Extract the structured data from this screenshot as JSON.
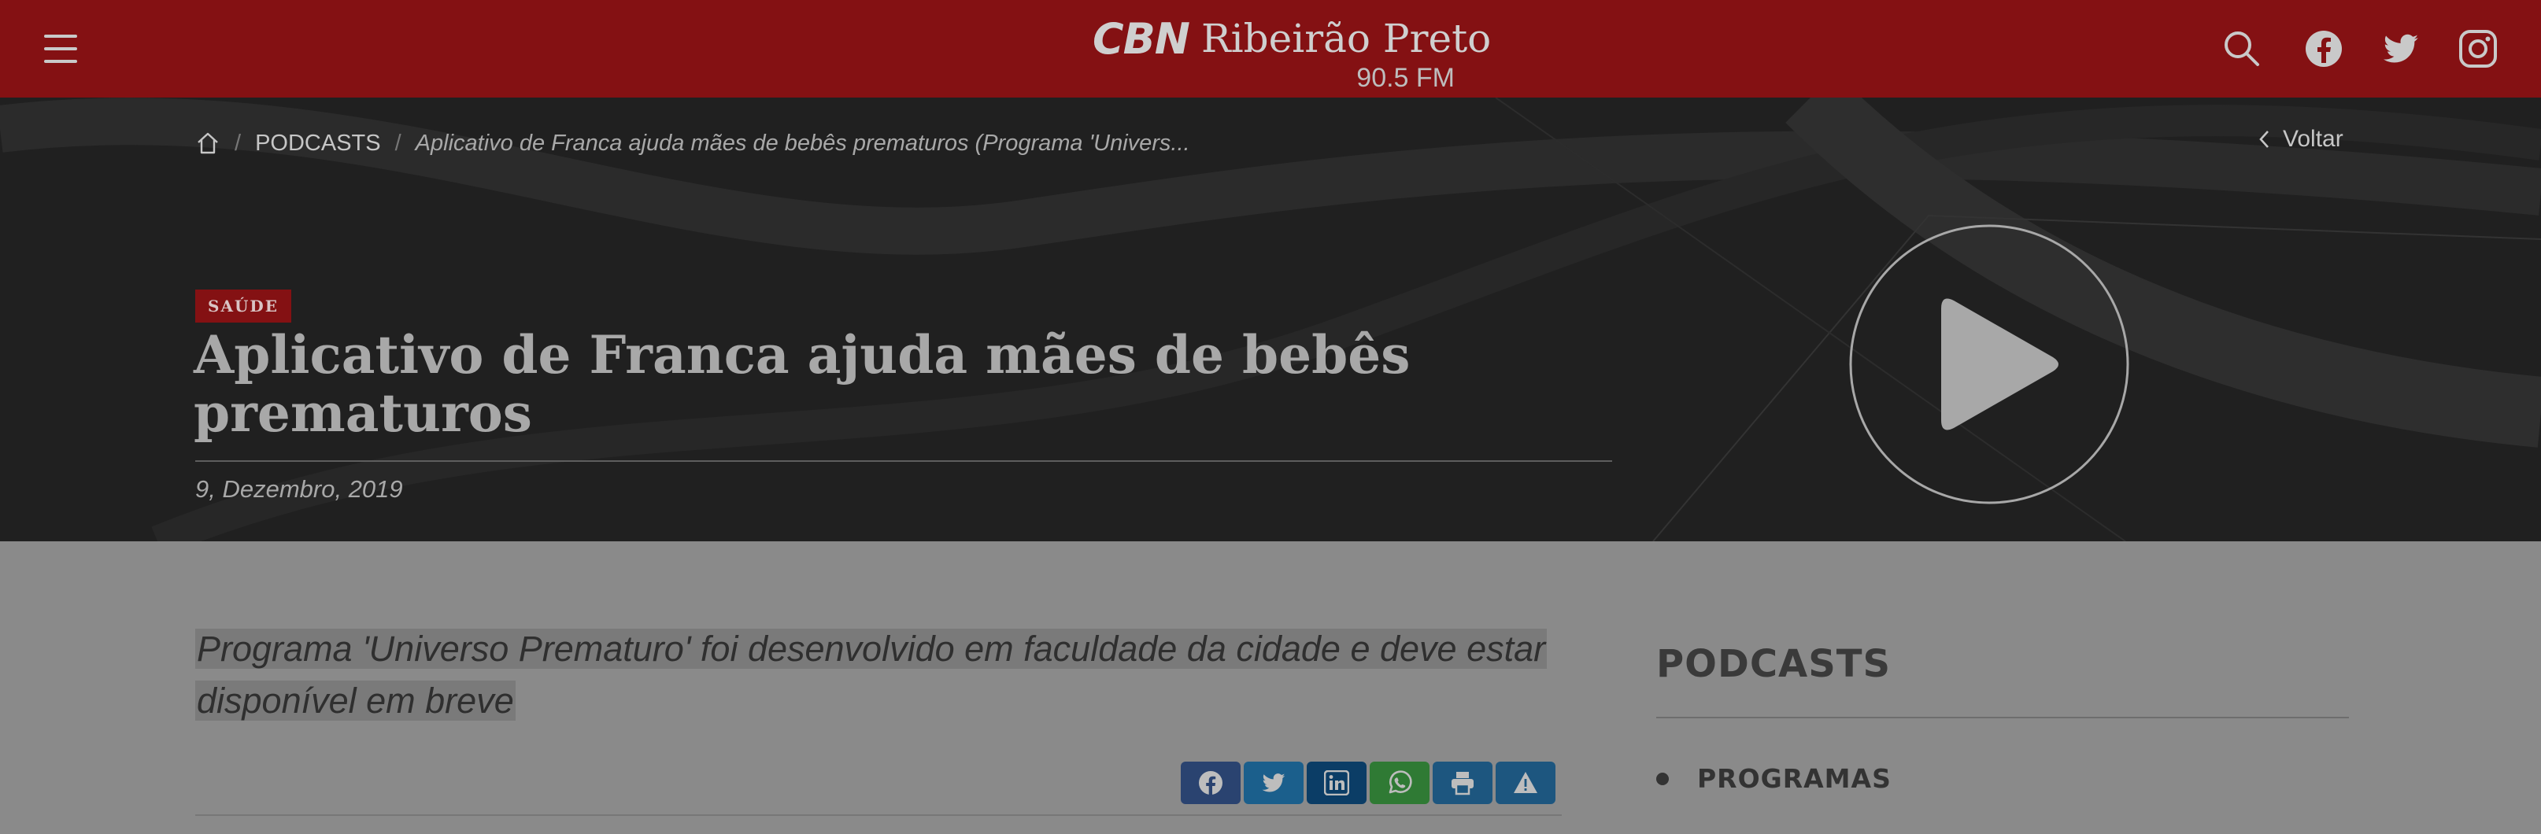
{
  "header": {
    "logo_brand": "CBN",
    "logo_city": "Ribeirão Preto",
    "logo_frequency": "90.5 FM",
    "icons": [
      "menu-icon",
      "search-icon",
      "facebook-icon",
      "twitter-icon",
      "instagram-icon"
    ]
  },
  "breadcrumb": {
    "home_icon": "home-icon",
    "separator": "/",
    "section": "PODCASTS",
    "current": "Aplicativo de Franca ajuda mães de bebês prematuros (Programa 'Univers..."
  },
  "back": {
    "label": "Voltar",
    "icon": "chevron-left-icon"
  },
  "article": {
    "category": "SAÚDE",
    "title": "Aplicativo de Franca ajuda mães de bebês prematuros",
    "date": "9, Dezembro, 2019",
    "subtitle": "Programa 'Universo Prematuro' foi desenvolvido em faculdade da cidade e deve estar disponível em breve",
    "play_icon": "play-icon"
  },
  "share": {
    "buttons": [
      {
        "name": "facebook",
        "icon": "facebook-icon",
        "color": "#2a4370"
      },
      {
        "name": "twitter",
        "icon": "twitter-icon",
        "color": "#1b5f8c"
      },
      {
        "name": "linkedin",
        "icon": "linkedin-icon",
        "color": "#0b3d66"
      },
      {
        "name": "whatsapp",
        "icon": "whatsapp-icon",
        "color": "#2f7a34"
      },
      {
        "name": "print",
        "icon": "print-icon",
        "color": "#1d567f"
      },
      {
        "name": "report",
        "icon": "alert-icon",
        "color": "#1d567f"
      }
    ]
  },
  "sidebar": {
    "title": "PODCASTS",
    "items": [
      {
        "label": "PROGRAMAS"
      }
    ]
  },
  "colors": {
    "brand_red": "#841113",
    "hero_background": "#202020",
    "page_overlay": "#8a8a8a"
  }
}
